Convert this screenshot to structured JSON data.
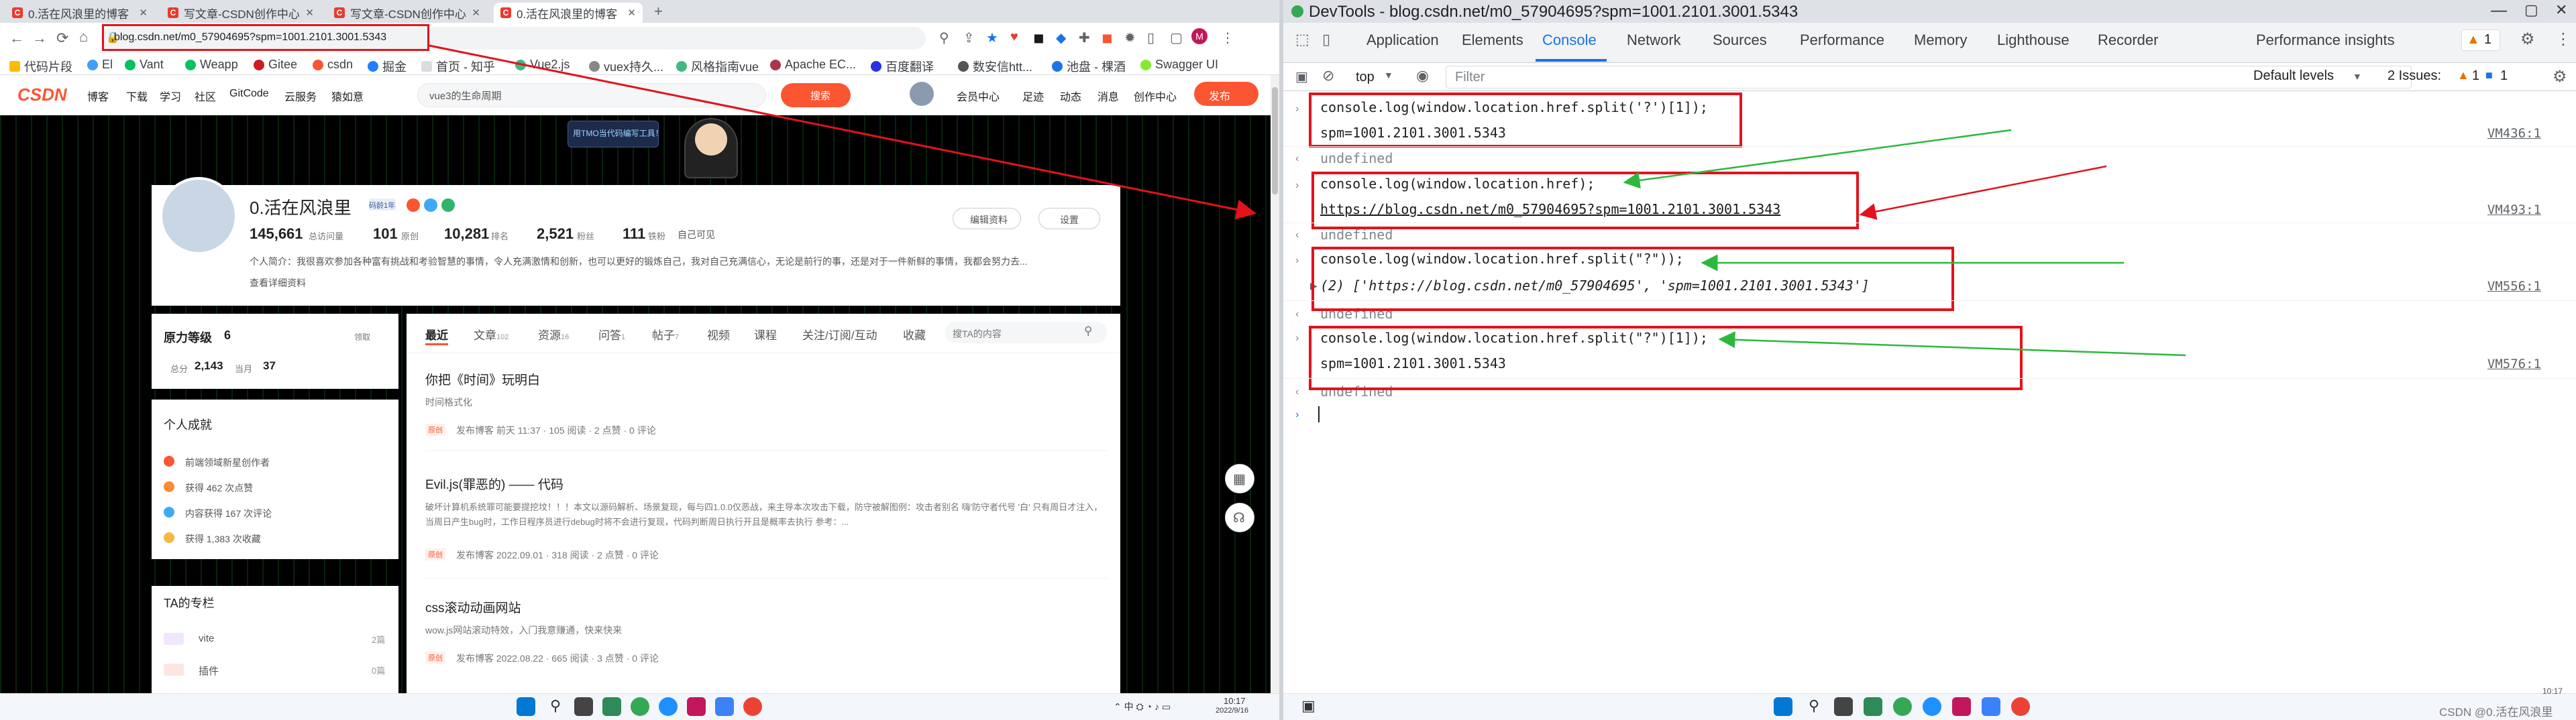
{
  "browser": {
    "tabs": [
      {
        "title": "0.活在风浪里的博客"
      },
      {
        "title": "写文章-CSDN创作中心"
      },
      {
        "title": "写文章-CSDN创作中心"
      },
      {
        "title": "0.活在风浪里的博客"
      }
    ],
    "url": "blog.csdn.net/m0_57904695?spm=1001.2101.3001.5343",
    "bookmarks": [
      "代码片段",
      "El",
      "Vant",
      "Weapp",
      "Gitee",
      "csdn",
      "掘金",
      "首页 - 知乎",
      "Vue2.js",
      "vuex持久...",
      "风格指南vue",
      "Apache EC...",
      "百度翻译",
      "数安信htt...",
      "池盘 - 棵酒",
      "Swagger UI"
    ]
  },
  "csdn": {
    "logo": "CSDN",
    "nav": [
      "博客",
      "下载",
      "学习",
      "社区",
      "GitCode",
      "云服务",
      "猿如意"
    ],
    "search_placeholder": "vue3的生命周期",
    "search_button": "搜索",
    "header_right": [
      "会员中心",
      "足迹",
      "动态",
      "消息",
      "创作中心"
    ],
    "publish": "发布",
    "banner": "用TMO当代码编写工具！",
    "profile": {
      "name": "0.活在风浪里",
      "badge": "码龄1年",
      "stats": [
        {
          "value": "145,661",
          "label": "总访问量"
        },
        {
          "value": "101",
          "label": "原创"
        },
        {
          "value": "10,281",
          "label": "排名"
        },
        {
          "value": "2,521",
          "label": "粉丝"
        },
        {
          "value": "111",
          "label": "铁粉"
        }
      ],
      "visibility": "自己可见",
      "edit": "编辑资料",
      "settings": "设置",
      "intro": "个人简介：我很喜欢参加各种富有挑战和考验智慧的事情，令人充满激情和创新，也可以更好的锻炼自己，我对自己充满信心，无论是前行的事，还是对于一件新鲜的事情，我都会努力去...",
      "more": "查看详细资料"
    },
    "level": {
      "title": "原力等级",
      "value": "6",
      "link": "领取",
      "total_label": "总分",
      "total": "2,143",
      "month_label": "当月",
      "month": "37"
    },
    "achievements": {
      "title": "个人成就",
      "items": [
        "前端领域新星创作者",
        "获得 462 次点赞",
        "内容获得 167 次评论",
        "获得 1,383 次收藏"
      ]
    },
    "columns": {
      "title": "TA的专栏",
      "items": [
        {
          "name": "vite",
          "count": "2篇"
        },
        {
          "name": "插件",
          "count": "0篇"
        }
      ]
    },
    "feed_tabs": [
      "最近",
      "文章",
      "资源",
      "问答",
      "帖子",
      "视频",
      "课程",
      "关注/订阅/互动",
      "收藏"
    ],
    "feed_counts": [
      "",
      "102",
      "16",
      "1",
      "7",
      "",
      "",
      "",
      ""
    ],
    "feed_search": "搜TA的内容",
    "articles": [
      {
        "title": "你把《时间》玩明白",
        "desc": "时间格式化",
        "tag": "原创",
        "meta": "发布博客 前天 11:37 · 105 阅读 · 2 点赞 · 0 评论"
      },
      {
        "title": "Evil.js(罪恶的) —— 代码",
        "desc": "破坏计算机系统罪可能要提挖坟！！！本文以源码解析、场景复现，每与四1.0.0仅恶战，来主导本次攻击下载，防守被解图例：攻击者别名 嗨'防守者代号 '白' 只有周日才注入，当周日产生bug时，工作日程序员进行debug时将不会进行复现，代码判断周日执行开且是概率去执行 参考：...",
        "tag": "原创",
        "meta": "发布博客 2022.09.01 · 318 阅读 · 2 点赞 · 0 评论"
      },
      {
        "title": "css滚动动画网站",
        "desc": "wow.js网站滚动特效，入门我意赚通，快来快来",
        "tag": "原创",
        "meta": "发布博客 2022.08.22 · 665 阅读 · 3 点赞 · 0 评论"
      }
    ]
  },
  "devtools": {
    "title": "DevTools - blog.csdn.net/m0_57904695?spm=1001.2101.3001.5343",
    "tabs": [
      "Application",
      "Elements",
      "Console",
      "Network",
      "Sources",
      "Performance",
      "Memory",
      "Lighthouse",
      "Recorder",
      "Performance insights"
    ],
    "active_tab": "Console",
    "warn_count": "1",
    "context": "top",
    "filter_placeholder": "Filter",
    "levels": "Default levels",
    "issues_label": "2 Issues:",
    "issues_warn": "1",
    "issues_info": "1",
    "entries": [
      {
        "input": "console.log(window.location.href.split('?')[1]);",
        "output": "spm=1001.2101.3001.5343",
        "source": "VM436:1",
        "ret": "undefined"
      },
      {
        "input": "console.log(window.location.href);",
        "output": "https://blog.csdn.net/m0_57904695?spm=1001.2101.3001.5343",
        "source": "VM493:1",
        "ret": "undefined"
      },
      {
        "input": "console.log(window.location.href.split(\"?\"));",
        "output": "(2) ['https://blog.csdn.net/m0_57904695', 'spm=1001.2101.3001.5343']",
        "source": "VM556:1",
        "ret": "undefined"
      },
      {
        "input": "console.log(window.location.href.split(\"?\")[1]);",
        "output": "spm=1001.2101.3001.5343",
        "source": "VM576:1",
        "ret": "undefined"
      }
    ]
  },
  "taskbar": {
    "time": "10:17",
    "date": "2022/9/16",
    "watermark": "CSDN @0.活在风浪里"
  },
  "colors": {
    "annotation_red": "#e3121b",
    "annotation_green": "#2db83d",
    "csdn_red": "#fc5531",
    "devtools_blue": "#1a73e8"
  }
}
